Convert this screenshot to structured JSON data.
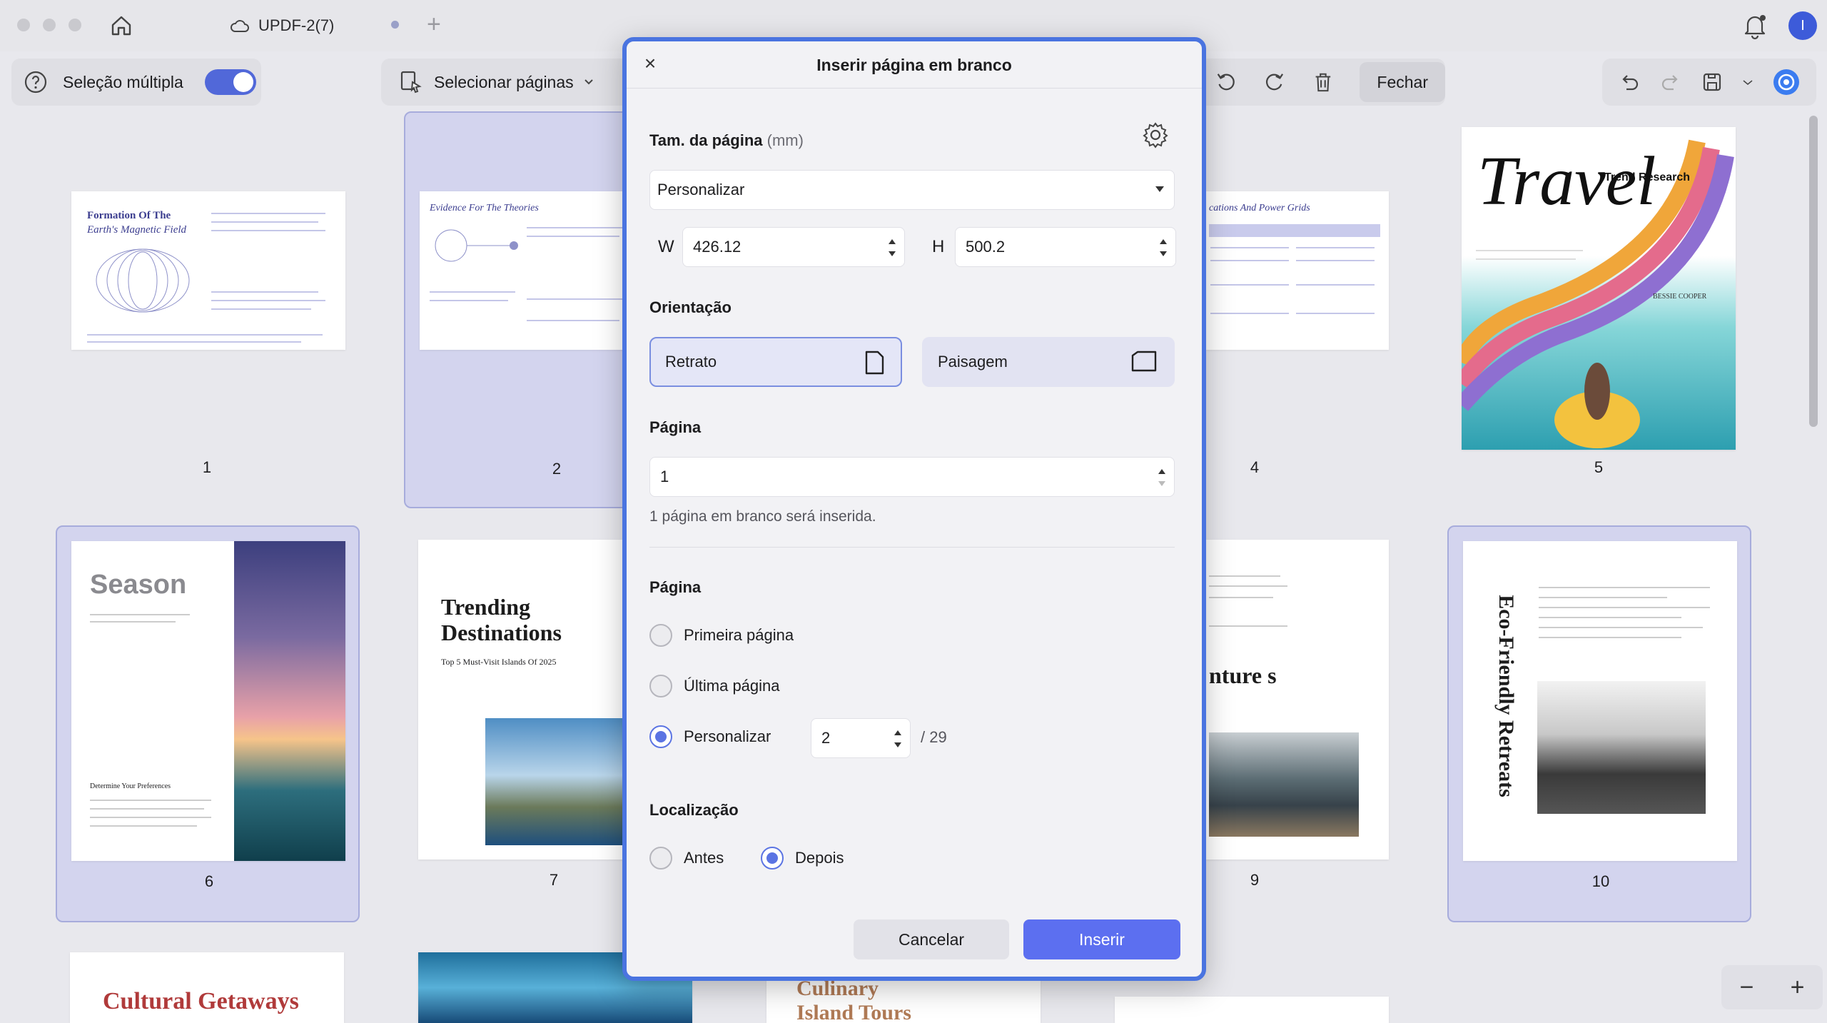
{
  "window": {
    "doc_name": "UPDF-2(7)",
    "avatar_letter": "I"
  },
  "toolbar": {
    "multi_select_label": "Seleção múltipla",
    "select_pages_label": "Selecionar páginas",
    "close_label": "Fechar"
  },
  "pages": {
    "numbers": [
      "1",
      "2",
      "4",
      "5",
      "6",
      "7",
      "9",
      "10"
    ],
    "p1": {
      "title": "Formation Of The",
      "subtitle": "Earth's Magnetic Field"
    },
    "p2": {
      "title": "Evidence For The Theories"
    },
    "p4": {
      "title": "cations And Power Grids"
    },
    "p5": {
      "title": "Travel",
      "subtitle": "Trend Research",
      "author": "BESSIE COOPER"
    },
    "p6": {
      "title": "Season",
      "sub": "Determine Your Preferences"
    },
    "p7": {
      "title": "Trending Destinations",
      "sub": "Top 5 Must-Visit Islands Of 2025"
    },
    "p9": {
      "title": "nture s"
    },
    "p10": {
      "title": "Eco-Friendly Retreats"
    },
    "row3": {
      "a": "Cultural Getaways",
      "c": "Culinary Island Tours"
    }
  },
  "dialog": {
    "title": "Inserir página em branco",
    "size_label": "Tam. da página",
    "size_unit": "(mm)",
    "size_select": "Personalizar",
    "w_label": "W",
    "w_value": "426.12",
    "h_label": "H",
    "h_value": "500.2",
    "orientation_label": "Orientação",
    "portrait": "Retrato",
    "landscape": "Paisagem",
    "page_count_label": "Página",
    "page_count_value": "1",
    "hint": "1 página em branco será inserida.",
    "position_label": "Página",
    "first_page": "Primeira página",
    "last_page": "Última página",
    "custom": "Personalizar",
    "custom_value": "2",
    "total": "/ 29",
    "location_label": "Localização",
    "before": "Antes",
    "after": "Depois",
    "cancel": "Cancelar",
    "insert": "Inserir"
  },
  "colors": {
    "accent": "#5c6ff0",
    "dialog_border": "#4a74e0",
    "selected_card": "#d3d4ee"
  }
}
